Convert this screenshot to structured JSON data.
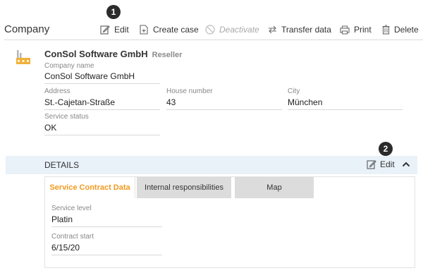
{
  "callouts": [
    "1",
    "2"
  ],
  "header": {
    "title": "Company"
  },
  "toolbar": {
    "edit": "Edit",
    "create_case": "Create case",
    "deactivate": "Deactivate",
    "transfer_data": "Transfer data",
    "print": "Print",
    "delete": "Delete"
  },
  "company": {
    "name": "ConSol Software GmbH",
    "type": "Reseller",
    "icon": "factory-icon",
    "fields": {
      "company_name": {
        "label": "Company name",
        "value": "ConSol Software GmbH"
      },
      "address": {
        "label": "Address",
        "value": "St.-Cajetan-Straße"
      },
      "house_number": {
        "label": "House number",
        "value": "43"
      },
      "city": {
        "label": "City",
        "value": "München"
      },
      "service_status": {
        "label": "Service status",
        "value": "OK"
      }
    }
  },
  "details": {
    "title": "DETAILS",
    "edit_label": "Edit",
    "tabs": [
      {
        "label": "Service Contract Data",
        "active": true
      },
      {
        "label": "Internal responsibilities",
        "active": false
      },
      {
        "label": "Map",
        "active": false
      }
    ],
    "fields": {
      "service_level": {
        "label": "Service level",
        "value": "Platin"
      },
      "contract_start": {
        "label": "Contract start",
        "value": "6/15/20"
      }
    }
  },
  "colors": {
    "accent": "#f39a1e",
    "details_bar": "#e9f1f9",
    "tab_inactive": "#dcdcdc",
    "badge": "#2b2b2b"
  }
}
